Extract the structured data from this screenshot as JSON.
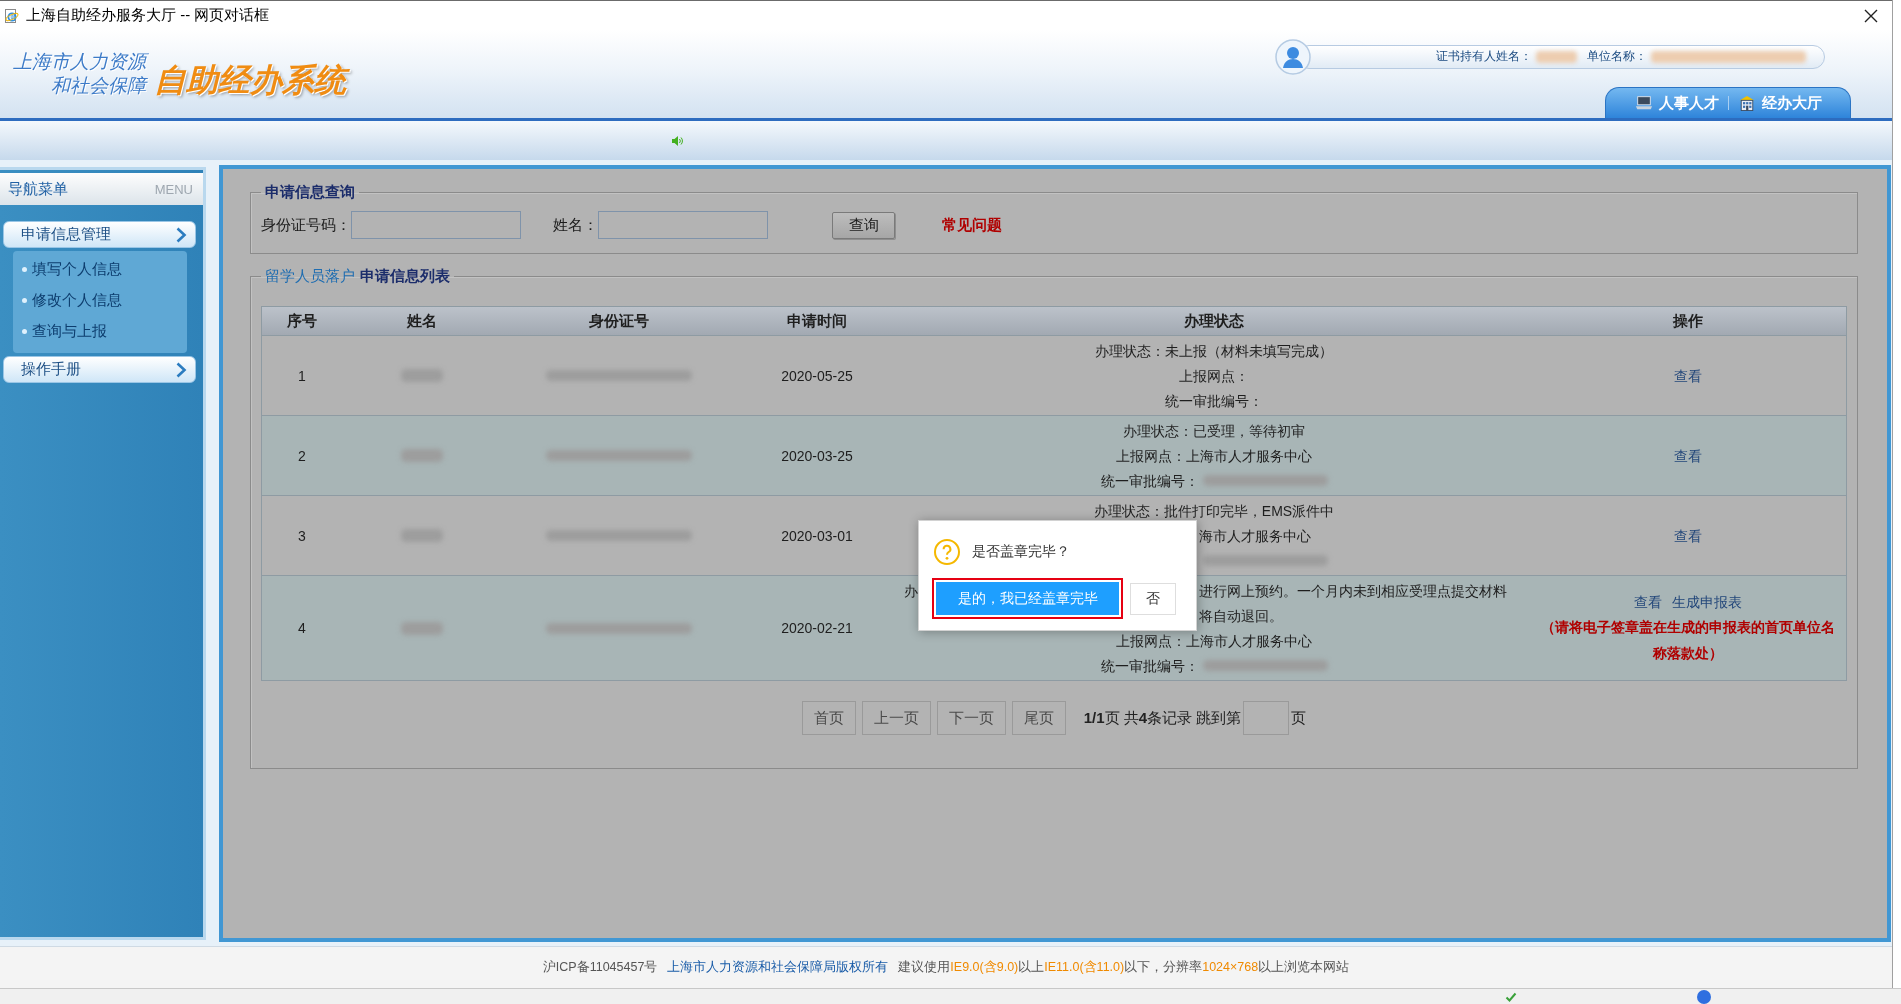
{
  "window": {
    "title": "上海自助经办服务大厅 -- 网页对话框"
  },
  "header": {
    "logo": {
      "org_lines": [
        "上海市人力资源",
        "和社会保障"
      ],
      "system_name": "自助经办系统"
    },
    "user_info": {
      "holder_label": "证书持有人姓名：",
      "unit_label": "单位名称："
    },
    "nav_tabs": [
      {
        "label": "人事人才",
        "kind": "talent"
      },
      {
        "label": "经办大厅",
        "kind": "hall"
      }
    ]
  },
  "sidebar": {
    "title": "导航菜单",
    "title_en": "MENU",
    "items": [
      {
        "label": "申请信息管理",
        "children": [
          {
            "label": "填写个人信息"
          },
          {
            "label": "修改个人信息"
          },
          {
            "label": "查询与上报"
          }
        ]
      },
      {
        "label": "操作手册"
      }
    ]
  },
  "search": {
    "legend": "申请信息查询",
    "fields": [
      {
        "label": "身份证号码："
      },
      {
        "label": "姓名："
      }
    ],
    "button": "查询",
    "help_link": "常见问题"
  },
  "list": {
    "legend_prefix": "留学人员落户",
    "legend": "申请信息列表",
    "table": {
      "columns": [
        "序号",
        "姓名",
        "身份证号",
        "申请时间",
        "办理状态",
        "操作"
      ],
      "rows": [
        {
          "index": "1",
          "date": "2020-05-25",
          "status": [
            {
              "kind": "full",
              "text": "办理状态：未上报（材料未填写完成）"
            },
            {
              "kind": "full",
              "text": "上报网点："
            },
            {
              "kind": "full",
              "text": "统一审批编号："
            }
          ],
          "actions": [
            "查看"
          ]
        },
        {
          "index": "2",
          "date": "2020-03-25",
          "status": [
            {
              "kind": "full",
              "text": "办理状态：已受理，等待初审"
            },
            {
              "kind": "full",
              "text": "上报网点：上海市人才服务中心"
            },
            {
              "kind": "full",
              "text": "统一审批编号：",
              "redacted": true
            }
          ],
          "actions": [
            "查看"
          ]
        },
        {
          "index": "3",
          "date": "2020-03-01",
          "status": [
            {
              "kind": "full",
              "text": "办理状态：批件打印完毕，EMS派件中"
            },
            {
              "kind": "covered",
              "after": "海市人才服务中心"
            },
            {
              "kind": "covered",
              "redacted": true
            }
          ],
          "actions": [
            "查看"
          ]
        },
        {
          "index": "4",
          "date": "2020-02-21",
          "status": [
            {
              "kind": "covered",
              "before": "办",
              "after": "进行网上预约。一个月内未到相应受理点提交材料"
            },
            {
              "kind": "covered",
              "after": "将自动退回。"
            },
            {
              "kind": "full",
              "text": "上报网点：上海市人才服务中心"
            },
            {
              "kind": "full",
              "text": "统一审批编号：",
              "redacted": true
            }
          ],
          "actions": [
            "查看",
            "生成申报表"
          ],
          "note": "（请将电子签章盖在生成的申报表的首页单位名称落款处）"
        }
      ]
    },
    "pagination": {
      "buttons": [
        "首页",
        "上一页",
        "下一页",
        "尾页"
      ],
      "summary": "**1/1**页 共**4**条记录 跳到第",
      "suffix": "页"
    }
  },
  "dialog": {
    "message": "是否盖章完毕？",
    "buttons": [
      {
        "label": "是的，我已经盖章完毕",
        "primary": true,
        "highlighted": true
      },
      {
        "label": "否",
        "primary": false,
        "highlighted": false
      }
    ]
  },
  "footer": {
    "icp": "沪ICP备11045457号",
    "copyright": "上海市人力资源和社会保障局版权所有",
    "notice": [
      {
        "text": "建议使用",
        "highlight": false
      },
      {
        "text": "IE9.0(含9.0)",
        "highlight": true
      },
      {
        "text": "以上",
        "highlight": false
      },
      {
        "text": "IE11.0(含11.0)",
        "highlight": true
      },
      {
        "text": "以下，分辨率",
        "highlight": false
      },
      {
        "text": "1024×768",
        "highlight": true
      },
      {
        "text": "以上浏览本网站",
        "highlight": false
      }
    ]
  }
}
